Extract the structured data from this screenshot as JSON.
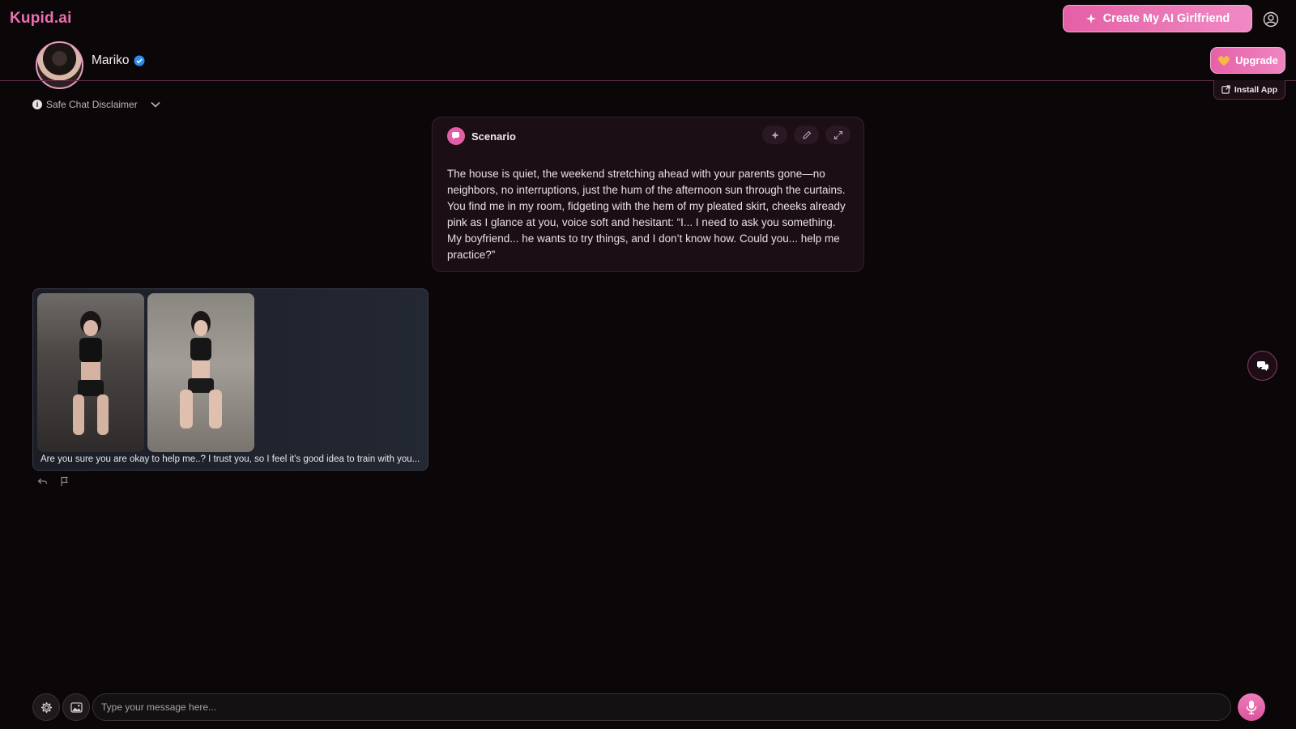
{
  "header": {
    "logo": "Kupid.ai",
    "create_button": "Create My AI Girlfriend",
    "upgrade_button": "Upgrade",
    "install_button": "Install App"
  },
  "character": {
    "name": "Mariko"
  },
  "disclaimer": {
    "label": "Safe Chat Disclaimer"
  },
  "scenario": {
    "title": "Scenario",
    "text": "The house is quiet, the weekend stretching ahead with your parents gone—no neighbors, no interruptions, just the hum of the afternoon sun through the curtains. You find me in my room, fidgeting with the hem of my pleated skirt, cheeks already pink as I glance at you, voice soft and hesitant: “I... I need to ask you something. My boyfriend... he wants to try things, and I don’t know how. Could you... help me practice?”"
  },
  "message": {
    "text": "Are you sure you are okay to help me..? I trust you, so I feel it's good idea to train with you...",
    "images": [
      "photo-1",
      "photo-2"
    ]
  },
  "composer": {
    "placeholder": "Type your message here..."
  },
  "colors": {
    "accent": "#e45fa6",
    "background": "#0b0608"
  }
}
